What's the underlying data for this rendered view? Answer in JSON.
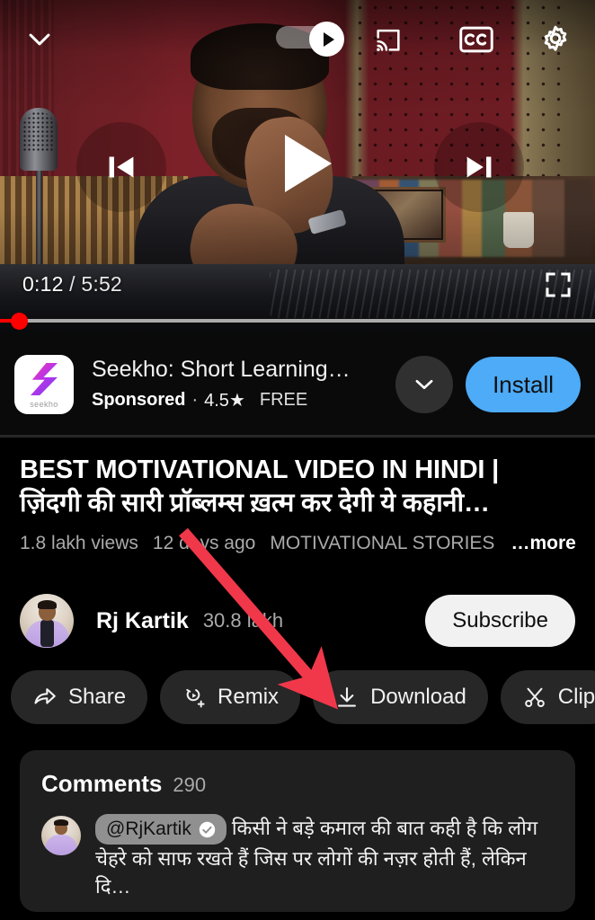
{
  "player": {
    "collapse_icon": "chevron-down-icon",
    "autoplay_label": "autoplay-toggle",
    "autoplay_state": "on",
    "cast_icon": "cast-icon",
    "captions_icon": "closed-captions-icon",
    "settings_icon": "gear-icon",
    "previous_icon": "previous-track-icon",
    "play_icon": "play-icon",
    "next_icon": "next-track-icon",
    "current_time": "0:12",
    "separator": "/",
    "duration": "5:52",
    "fullscreen_icon": "fullscreen-icon",
    "progress_percent": 3.4
  },
  "ad": {
    "app_icon_word": "seekho",
    "title": "Seekho: Short Learning…",
    "sponsored": "Sponsored",
    "dot": "·",
    "rating": "4.5",
    "star": "★",
    "price": "FREE",
    "expand_icon": "chevron-down-icon",
    "install_label": "Install",
    "install_color": "#4dabf7"
  },
  "video": {
    "title_line1": "BEST MOTIVATIONAL VIDEO IN HINDI |",
    "title_line2": "ज़िंदगी की सारी प्रॉब्लम्स ख़त्म कर देगी ये कहानी…",
    "views": "1.8 lakh views",
    "published": "12 days ago",
    "tag": "MOTIVATIONAL STORIES",
    "more": "…more"
  },
  "channel": {
    "name": "Rj Kartik",
    "subscribers": "30.8 lakh",
    "subscribe_label": "Subscribe"
  },
  "actions": [
    {
      "label": "Share",
      "icon": "share-icon"
    },
    {
      "label": "Remix",
      "icon": "remix-icon"
    },
    {
      "label": "Download",
      "icon": "download-icon"
    },
    {
      "label": "Clip",
      "icon": "scissors-icon"
    }
  ],
  "comments": {
    "title": "Comments",
    "count": "290",
    "top_comment": {
      "handle": "@RjKartik",
      "verified_icon": "verified-badge-icon",
      "text": "किसी ने बड़े कमाल की बात कही है कि लोग चेहरे को साफ रखते हैं जिस पर लोगों की नज़र होती हैं, लेकिन दि…"
    }
  },
  "annotation": {
    "type": "arrow",
    "color": "#f0384a",
    "points_to": "Download"
  }
}
